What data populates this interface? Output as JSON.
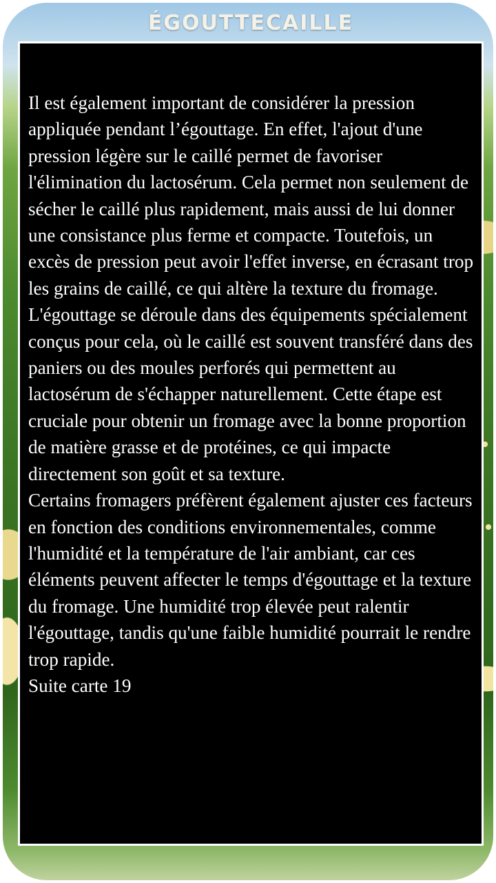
{
  "brand": {
    "title": "ÉGOUTTECAILLE"
  },
  "content": {
    "paragraphs": [
      "Il est également important de considérer la pression appliquée pendant l’égouttage. En effet, l'ajout d'une pression légère sur le caillé permet de favoriser l'élimination du lactosérum. Cela permet non seulement de sécher le caillé plus rapidement, mais aussi de lui donner une consistance plus ferme et compacte. Toutefois, un excès de pression peut avoir l'effet inverse, en écrasant trop les grains de caillé, ce qui altère la texture du fromage.",
      "L'égouttage se déroule dans des équipements spécialement conçus pour cela, où le caillé est souvent transféré dans des paniers ou des moules perforés qui permettent au lactosérum de s'échapper naturellement. Cette étape est cruciale pour obtenir un fromage avec la bonne proportion de matière grasse et de protéines, ce qui impacte directement son goût et sa texture.",
      "Certains fromagers préfèrent également ajuster ces facteurs en fonction des conditions environnementales, comme l'humidité et la température de l'air ambiant, car ces éléments peuvent affecter le temps d'égouttage et la texture du fromage. Une humidité trop élevée peut ralentir l'égouttage, tandis qu'une faible humidité pourrait le rendre trop rapide.",
      "Suite carte 19"
    ]
  },
  "colors": {
    "panel_background": "#000000",
    "text": "#ffffff",
    "border": "#ffffff"
  }
}
